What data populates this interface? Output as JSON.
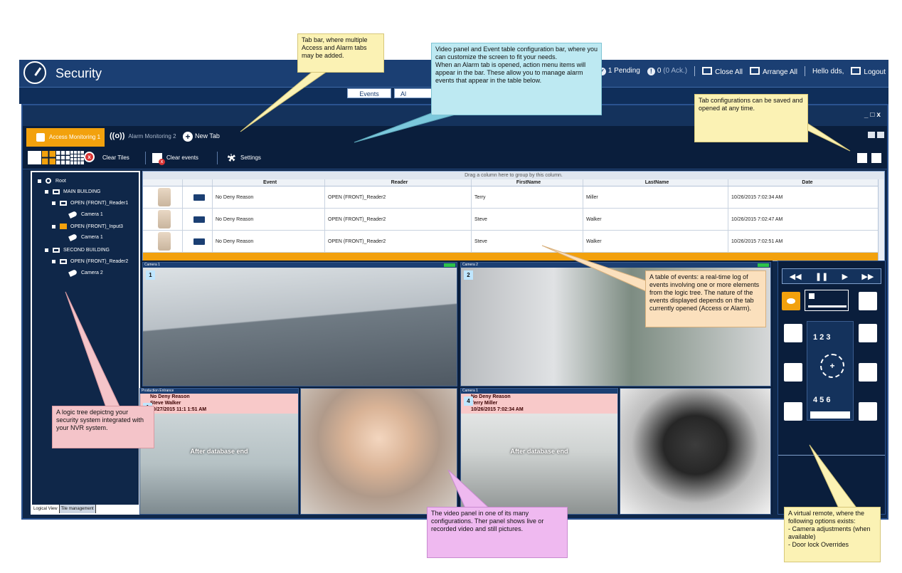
{
  "app": {
    "title": "Security",
    "pending": "1 Pending",
    "ack_count": "0",
    "ack_label": "(0 Ack.)",
    "close_all": "Close All",
    "arrange_all": "Arrange All",
    "greeting": "Hello dds,",
    "logout": "Logout"
  },
  "nav": {
    "events": "Events",
    "alarms": "Al"
  },
  "tabs": {
    "access": "Access Monitoring 1",
    "alarm": "Alarm Monitoring 2",
    "new_tab": "New Tab"
  },
  "toolbar": {
    "clear_tiles": "Clear Tiles",
    "clear_events": "Clear events",
    "settings": "Settings"
  },
  "tree": {
    "nodes": [
      {
        "label": "Root",
        "depth": 0,
        "icon": "globe-icon"
      },
      {
        "label": "MAIN BUILDING",
        "depth": 1,
        "icon": "building-icon"
      },
      {
        "label": "OPEN (FRONT)_Reader1",
        "depth": 2,
        "icon": "reader-icon"
      },
      {
        "label": "Camera 1",
        "depth": 3,
        "icon": "camera-icon"
      },
      {
        "label": "OPEN (FRONT)_Input3",
        "depth": 2,
        "icon": "door-icon"
      },
      {
        "label": "Camera 1",
        "depth": 3,
        "icon": "camera-icon"
      },
      {
        "label": "SECOND BUILDING",
        "depth": 1,
        "icon": "building-icon"
      },
      {
        "label": "OPEN (FRONT)_Reader2",
        "depth": 2,
        "icon": "reader-icon"
      },
      {
        "label": "Camera 2",
        "depth": 3,
        "icon": "camera-icon"
      }
    ],
    "tab_logical": "Logical View",
    "tab_tiles": "Tile management"
  },
  "events": {
    "group_hint": "Drag a column here to group by this column.",
    "columns": [
      "Event",
      "Reader",
      "FirstName",
      "LastName",
      "Date"
    ],
    "rows": [
      {
        "event": "No Deny Reason",
        "reader": "OPEN (FRONT)_Reader2",
        "first": "Terry",
        "last": "Miller",
        "date": "10/26/2015 7:02:34 AM"
      },
      {
        "event": "No Deny Reason",
        "reader": "OPEN (FRONT)_Reader2",
        "first": "Steve",
        "last": "Walker",
        "date": "10/26/2015 7:02:47 AM"
      },
      {
        "event": "No Deny Reason",
        "reader": "OPEN (FRONT)_Reader2",
        "first": "Steve",
        "last": "Walker",
        "date": "10/26/2015 7:02:51 AM"
      }
    ]
  },
  "video": {
    "tile1": {
      "header": "Camera 1",
      "num": "1",
      "live": "Live"
    },
    "tile2": {
      "header": "Camera 2",
      "num": "2",
      "live": "Live"
    },
    "tile3": {
      "header": "Production Entrance",
      "num": "1",
      "alarm1": "No Deny Reason",
      "alarm2": "Steve Walker",
      "alarm3": "10/27/2015 11:1 1:51 AM",
      "overlay": "After database end"
    },
    "tile4": {
      "header": "Camera 1",
      "num": "4",
      "alarm1": "No Deny Reason",
      "alarm2": "Terry Miller",
      "alarm3": "10/26/2015 7:02:34 AM",
      "overlay": "After database end"
    }
  },
  "remote": {
    "keys_top": "1  2  3",
    "keys_bottom": "4  5  6"
  },
  "callouts": {
    "tabbar": "Tab bar, where multiple Access and Alarm tabs may be added.",
    "config": "Video panel and Event table configuration bar, where you can customize the screen to fit your needs.\nWhen an Alarm tab is opened, action menu items will appear in the bar. These allow you to manage alarm events that appear in the table below.",
    "tabconfig": "Tab configurations can be saved and opened at any time.",
    "table": "A table of events: a real-time log of events involving one or more elements from the logic tree. The nature of the events displayed depends on the tab currently opened (Access or Alarm).",
    "tree": "A logic tree depictng your security system integrated with your NVR system.",
    "video": "The video panel in one of its many configurations. Ther panel shows live or recorded video and still pictures.",
    "remote": "A virtual remote, where the following options exists:\n - Camera adjustments (when available)\n - Door lock Overrides"
  },
  "colors": {
    "accent": "#f2a10d",
    "header": "#1b3f73",
    "panel": "#0f2749"
  }
}
